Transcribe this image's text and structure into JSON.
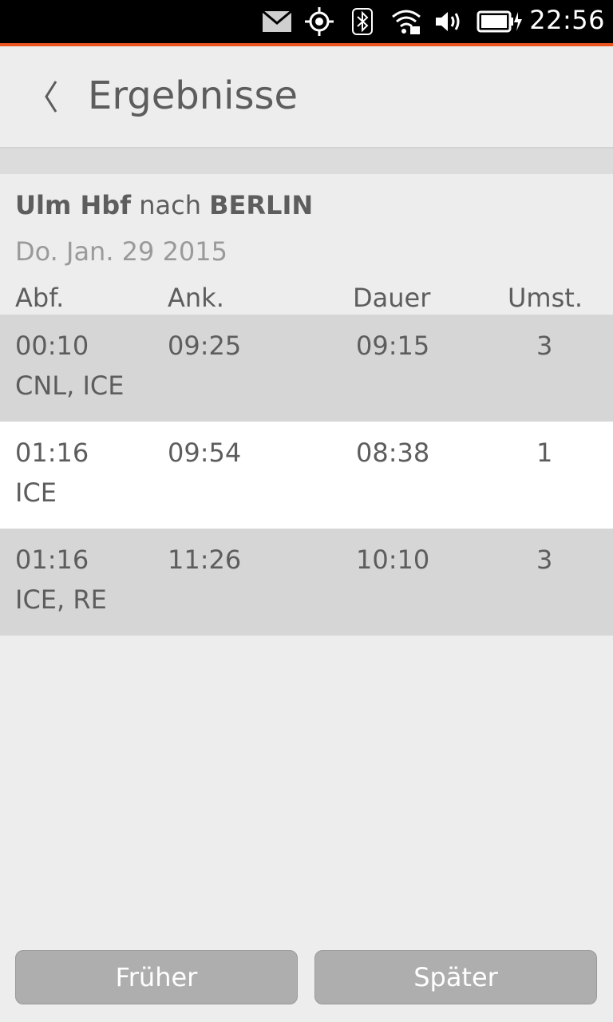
{
  "status_bar": {
    "time": "22:56",
    "icons": [
      "mail-icon",
      "location-icon",
      "bluetooth-icon",
      "wifi-icon",
      "volume-icon",
      "battery-charging-icon"
    ]
  },
  "colors": {
    "accent": "#e95420",
    "row_shade": "#d6d6d6",
    "button": "#aeaeae"
  },
  "header": {
    "title": "Ergebnisse"
  },
  "route": {
    "from": "Ulm Hbf",
    "connector": "nach",
    "to": "BERLIN",
    "date": "Do. Jan. 29 2015"
  },
  "columns": {
    "departure": "Abf.",
    "arrival": "Ank.",
    "duration": "Dauer",
    "changes": "Umst."
  },
  "connections": [
    {
      "departure": "00:10",
      "arrival": "09:25",
      "duration": "09:15",
      "changes": "3",
      "trains": "CNL, ICE"
    },
    {
      "departure": "01:16",
      "arrival": "09:54",
      "duration": "08:38",
      "changes": "1",
      "trains": "ICE"
    },
    {
      "departure": "01:16",
      "arrival": "11:26",
      "duration": "10:10",
      "changes": "3",
      "trains": "ICE, RE"
    }
  ],
  "buttons": {
    "earlier": "Früher",
    "later": "Später"
  }
}
